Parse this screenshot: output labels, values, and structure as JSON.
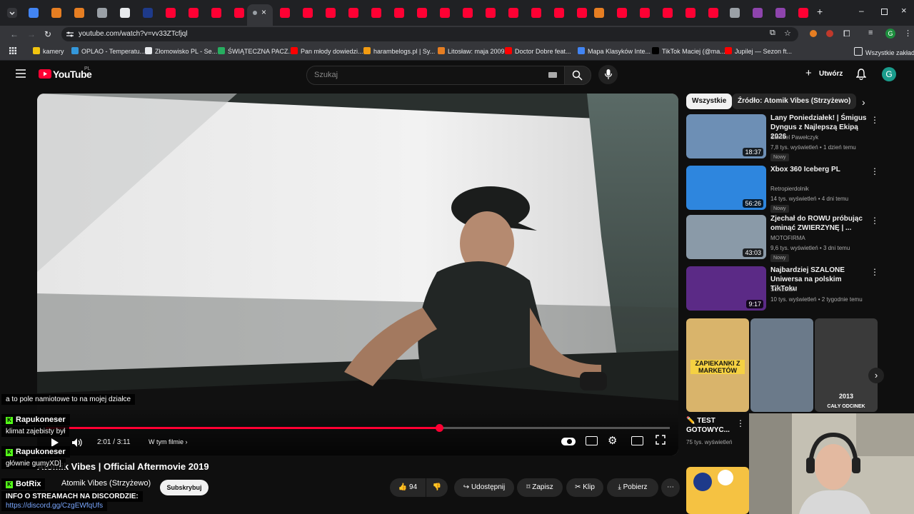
{
  "browser": {
    "url": "youtube.com/watch?v=vv33ZTcfjql",
    "bookmarks": [
      {
        "label": "kamery",
        "color": "#f1c40f"
      },
      {
        "label": "OPLAO - Temperatu...",
        "color": "#3498db"
      },
      {
        "label": "Złomowisko PL - Se...",
        "color": "#e8eaed"
      },
      {
        "label": "ŚWIĄTECZNA PACZ...",
        "color": "#27ae60"
      },
      {
        "label": "Pan młody dowiedzi...",
        "color": "#ff0000"
      },
      {
        "label": "harambelogs.pl | Sy...",
        "color": "#f39c12"
      },
      {
        "label": "Litosław: maja 2009",
        "color": "#e67e22"
      },
      {
        "label": "Doctor Dobre feat...",
        "color": "#ff0000"
      },
      {
        "label": "Mapa Klasyków Inte...",
        "color": "#4285f4"
      },
      {
        "label": "TikTok Maciej (@ma...",
        "color": "#000000"
      },
      {
        "label": "Jupilej — Sezon ft...",
        "color": "#ff0000"
      }
    ],
    "all_bookmarks": "Wszystkie zakładki",
    "profile_letter": "G"
  },
  "youtube": {
    "logo": "YouTube",
    "region": "PL",
    "search_placeholder": "Szukaj",
    "create_label": "Utwórz",
    "avatar_letter": "G"
  },
  "player": {
    "time": "2:01 / 3:11",
    "chapters_label": "W tym filmie",
    "progress": 0.63
  },
  "video": {
    "title": "Atomik Vibes | Official Aftermovie 2019",
    "channel": "Atomik Vibes (Strzyżewo)",
    "subscribe": "Subskrybuj",
    "likes": "94",
    "share": "Udostępnij",
    "save": "Zapisz",
    "clip": "Klip",
    "download": "Pobierz"
  },
  "filters": {
    "all": "Wszystkie",
    "source": "Źródło: Atomik Vibes (Strzyżewo)"
  },
  "recommendations": [
    {
      "title": "Lany Poniedziałek! | Śmigus Dyngus z Najlepszą Ekipą 2026",
      "channel": "Samuel Pawełczyk",
      "meta": "7,8 tys. wyświetleń • 1 dzień temu",
      "badge": "Nowy",
      "duration": "18:37",
      "color": "#6d8fb5"
    },
    {
      "title": "Xbox 360 Iceberg PL",
      "channel": "Retropierdolnik",
      "meta": "14 tys. wyświetleń • 4 dni temu",
      "badge": "Nowy",
      "duration": "56:26",
      "color": "#2e86de"
    },
    {
      "title": "Zjechał do ROWU próbując ominąć ZWIERZYNĘ | ...",
      "channel": "MOTOFIRMA",
      "meta": "9,6 tys. wyświetleń • 3 dni temu",
      "badge": "Nowy",
      "duration": "43:03",
      "color": "#8a9aa8"
    },
    {
      "title": "Najbardziej SZALONE Uniwersa na polskim TikToku",
      "channel": "Schizolum",
      "meta": "10 tys. wyświetleń • 2 tygodnie temu",
      "badge": "",
      "duration": "9:17",
      "color": "#5b2a86"
    }
  ],
  "shorts": [
    {
      "caption": "ZAPIEKANKI Z MARKETÓW",
      "color": "#d9b46b"
    },
    {
      "caption": "",
      "color": "#6b7a8a"
    },
    {
      "caption": "2013",
      "subcaption": "CAŁY ODCINEK",
      "color": "#3a3a3a"
    }
  ],
  "shorts_card": {
    "title": "✏️ TEST GOTOWYC...",
    "meta": "75 tys. wyświetleń"
  },
  "chat": [
    {
      "type": "msg",
      "text": "a to pole namiotowe to na mojej działce"
    },
    {
      "type": "name",
      "text": "Rapukoneser"
    },
    {
      "type": "msg",
      "text": "klimat zajebisty był"
    },
    {
      "type": "name",
      "text": "Rapukoneser"
    },
    {
      "type": "msg",
      "text": "głównie gumyXD]"
    },
    {
      "type": "name",
      "text": "BotRix"
    },
    {
      "type": "msg",
      "text": "INFO O STREAMACH NA DISCORDZIE:"
    },
    {
      "type": "link",
      "text": "https://discord.gg/CzgEWfqUfs"
    }
  ],
  "colors": {
    "accent": "#ff0033",
    "discord_link": "#7aa7ff",
    "kick_green": "#53fc18"
  }
}
